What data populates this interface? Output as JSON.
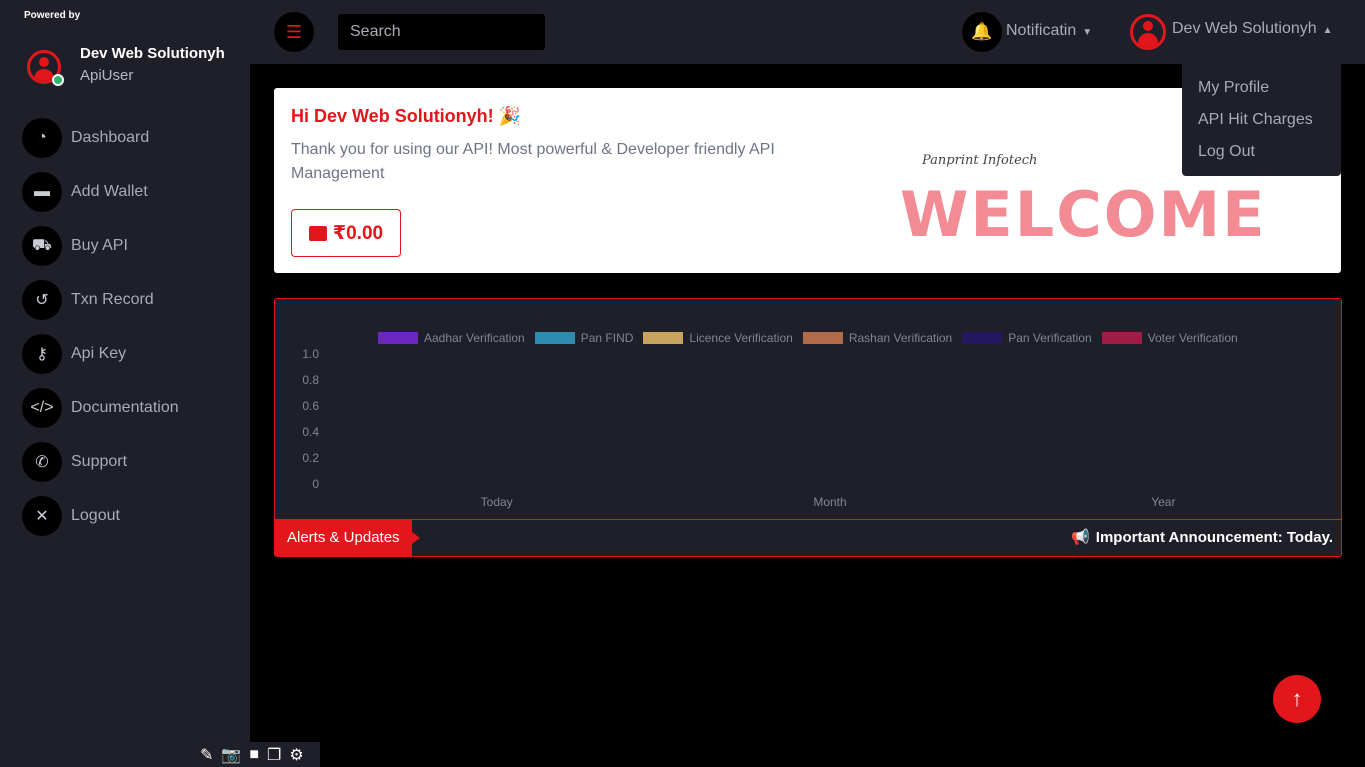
{
  "sidebar": {
    "powered_by": "Powered by",
    "user_name": "Dev Web Solutionyh",
    "user_role": "ApiUser",
    "items": [
      {
        "label": "Dashboard",
        "icon": "gauge-icon"
      },
      {
        "label": "Add Wallet",
        "icon": "wallet-icon"
      },
      {
        "label": "Buy API",
        "icon": "cart-icon"
      },
      {
        "label": "Txn Record",
        "icon": "history-icon"
      },
      {
        "label": "Api Key",
        "icon": "key-icon"
      },
      {
        "label": "Documentation",
        "icon": "code-icon"
      },
      {
        "label": "Support",
        "icon": "phone-icon"
      },
      {
        "label": "Logout",
        "icon": "close-icon"
      }
    ]
  },
  "topbar": {
    "search_placeholder": "Search",
    "notifications_label": "Notificatin",
    "profile_label": "Dev Web Solutionyh"
  },
  "dropdown": {
    "items": [
      "My Profile",
      "API Hit Charges",
      "Log Out"
    ]
  },
  "welcome": {
    "greeting": "Hi Dev Web Solutionyh! 🎉",
    "message": "Thank you for using our API! Most powerful & Developer friendly API Management",
    "balance": "₹0.00",
    "art_signature": "Panprint Infotech",
    "art_word": "WELCOME"
  },
  "chart_data": {
    "type": "bar",
    "categories": [
      "Today",
      "Month",
      "Year"
    ],
    "series": [
      {
        "name": "Aadhar Verification",
        "color": "#6a28c2",
        "values": [
          0,
          0,
          0
        ]
      },
      {
        "name": "Pan FIND",
        "color": "#2e8bb0",
        "values": [
          0,
          0,
          0
        ]
      },
      {
        "name": "Licence Verification",
        "color": "#c9a45c",
        "values": [
          0,
          0,
          0
        ]
      },
      {
        "name": "Rashan Verification",
        "color": "#b06c4a",
        "values": [
          0,
          0,
          0
        ]
      },
      {
        "name": "Pan Verification",
        "color": "#24185e",
        "values": [
          0,
          0,
          0
        ]
      },
      {
        "name": "Voter Verification",
        "color": "#9e1d46",
        "values": [
          0,
          0,
          0
        ]
      }
    ],
    "yticks": [
      "1.0",
      "0.8",
      "0.6",
      "0.4",
      "0.2",
      "0"
    ],
    "ylim": [
      0,
      1
    ],
    "legend_position": "top",
    "grid": false
  },
  "alerts": {
    "tag": "Alerts & Updates",
    "announcement": "Important Announcement: Today."
  }
}
